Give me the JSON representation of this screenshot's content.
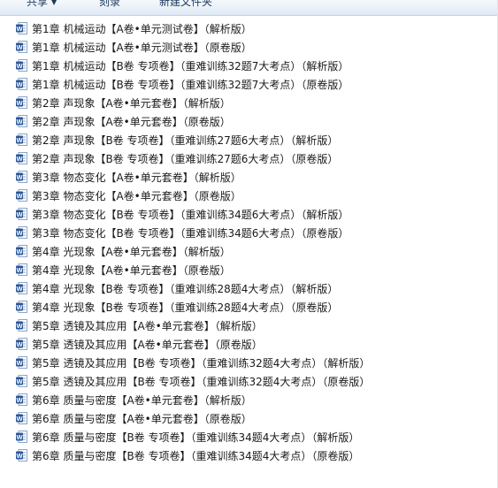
{
  "toolbar": {
    "share_label": "共享",
    "burn_label": "刻录",
    "new_folder_label": "新建文件夹"
  },
  "files": [
    "第1章 机械运动【A卷•单元测试卷】（解析版）",
    "第1章 机械运动【A卷•单元测试卷】（原卷版）",
    "第1章 机械运动【B卷 专项卷】（重难训练32题7大考点）（解析版）",
    "第1章 机械运动【B卷 专项卷】（重难训练32题7大考点）（原卷版）",
    "第2章 声现象【A卷•单元套卷】（解析版）",
    "第2章 声现象【A卷•单元套卷】（原卷版）",
    "第2章 声现象【B卷 专项卷】（重难训练27题6大考点）（解析版）",
    "第2章 声现象【B卷 专项卷】（重难训练27题6大考点）（原卷版）",
    "第3章 物态变化【A卷•单元套卷】（解析版）",
    "第3章 物态变化【A卷•单元套卷】（原卷版）",
    "第3章 物态变化【B卷 专项卷】（重难训练34题6大考点）（解析版）",
    "第3章 物态变化【B卷 专项卷】（重难训练34题6大考点）（原卷版）",
    "第4章 光现象【A卷•单元套卷】（解析版）",
    "第4章 光现象【A卷•单元套卷】（原卷版）",
    "第4章 光现象【B卷 专项卷】（重难训练28题4大考点）（解析版）",
    "第4章 光现象【B卷 专项卷】（重难训练28题4大考点）（原卷版）",
    "第5章 透镜及其应用【A卷•单元套卷】（解析版）",
    "第5章 透镜及其应用【A卷•单元套卷】（原卷版）",
    "第5章 透镜及其应用【B卷 专项卷】（重难训练32题4大考点）（解析版）",
    "第5章 透镜及其应用【B卷 专项卷】（重难训练32题4大考点）（原卷版）",
    "第6章 质量与密度【A卷•单元套卷】（解析版）",
    "第6章 质量与密度【A卷•单元套卷】（原卷版）",
    "第6章 质量与密度【B卷 专项卷】（重难训练34题4大考点）（解析版）",
    "第6章 质量与密度【B卷 专项卷】（重难训练34题4大考点）（原卷版）"
  ],
  "icon": "word-doc-icon",
  "colors": {
    "word_blue": "#2b5797",
    "text": "#1a1a1a"
  }
}
